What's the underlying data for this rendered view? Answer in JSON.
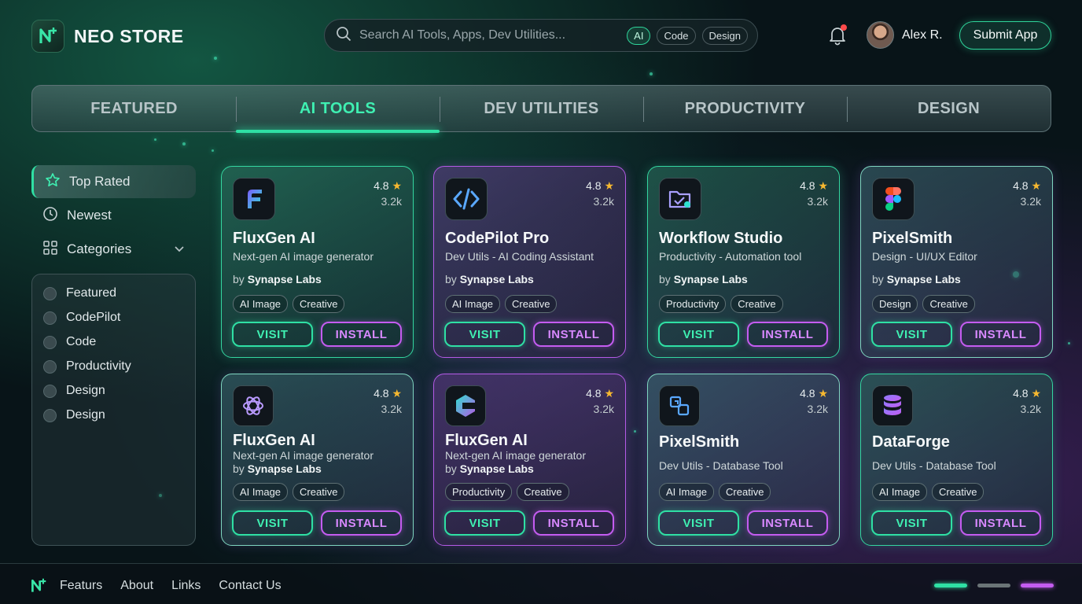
{
  "app": {
    "name": "NEO STORE"
  },
  "search": {
    "placeholder": "Search AI Tools, Apps, Dev Utilities...",
    "chips": [
      "AI",
      "Code",
      "Design"
    ],
    "active_chip": "AI"
  },
  "user": {
    "name": "Alex R."
  },
  "header": {
    "submit_label": "Submit App"
  },
  "tabs": [
    "FEATURED",
    "AI TOOLS",
    "DEV UTILITIES",
    "PRODUCTIVITY",
    "DESIGN"
  ],
  "active_tab": "AI TOOLS",
  "sidebar": {
    "items": [
      {
        "label": "Top Rated",
        "icon": "star-icon"
      },
      {
        "label": "Newest",
        "icon": "clock-icon"
      },
      {
        "label": "Categories",
        "icon": "grid-icon"
      }
    ],
    "filters": [
      "Featured",
      "CodePilot",
      "Code",
      "Productivity",
      "Design",
      "Design"
    ]
  },
  "cards": [
    {
      "title": "FluxGen AI",
      "subtitle": "Next-gen AI image generator",
      "by_prefix": "by",
      "by": "Synapse Labs",
      "rating": "4.8",
      "count": "3.2k",
      "tags": [
        "AI Image",
        "Creative"
      ],
      "visit": "VISIT",
      "install": "INSTALL",
      "icon": "fluxgen-logo-icon"
    },
    {
      "title": "CodePilot Pro",
      "subtitle": "Dev Utils - AI Coding Assistant",
      "by_prefix": "by",
      "by": "Synapse Labs",
      "rating": "4.8",
      "count": "3.2k",
      "tags": [
        "AI Image",
        "Creative"
      ],
      "visit": "VISIT",
      "install": "INSTALL",
      "icon": "code-brackets-icon"
    },
    {
      "title": "Workflow Studio",
      "subtitle": "Productivity - Automation tool",
      "by_prefix": "by",
      "by": "Synapse Labs",
      "rating": "4.8",
      "count": "3.2k",
      "tags": [
        "Productivity",
        "Creative"
      ],
      "visit": "VISIT",
      "install": "INSTALL",
      "icon": "folder-check-icon"
    },
    {
      "title": "PixelSmith",
      "subtitle": "Design - UI/UX Editor",
      "by_prefix": "by",
      "by": "Synapse Labs",
      "rating": "4.8",
      "count": "3.2k",
      "tags": [
        "Design",
        "Creative"
      ],
      "visit": "VISIT",
      "install": "INSTALL",
      "icon": "figma-logo-icon"
    },
    {
      "title": "FluxGen AI",
      "subtitle": "Next-gen AI image generator",
      "by_prefix": "by",
      "by": "Synapse Labs",
      "rating": "4.8",
      "count": "3.2k",
      "tags": [
        "AI Image",
        "Creative"
      ],
      "visit": "VISIT",
      "install": "INSTALL",
      "icon": "openai-logo-icon"
    },
    {
      "title": "FluxGen AI",
      "subtitle": "Next-gen AI image generator",
      "by_prefix": "by",
      "by": "Synapse Labs",
      "rating": "4.8",
      "count": "3.2k",
      "tags": [
        "Productivity",
        "Creative"
      ],
      "visit": "VISIT",
      "install": "INSTALL",
      "icon": "e-logo-icon"
    },
    {
      "title": "PixelSmith",
      "subtitle": "Dev Utils - Database Tool",
      "rating": "4.8",
      "count": "3.2k",
      "tags": [
        "AI Image",
        "Creative"
      ],
      "visit": "VISIT",
      "install": "INSTALL",
      "icon": "database-link-icon"
    },
    {
      "title": "DataForge",
      "subtitle": "Dev Utils - Database Tool",
      "rating": "4.8",
      "count": "3.2k",
      "tags": [
        "AI Image",
        "Creative"
      ],
      "visit": "VISIT",
      "install": "INSTALL",
      "icon": "database-icon"
    }
  ],
  "footer": {
    "links": [
      "Featurs",
      "About",
      "Links",
      "Contact Us"
    ]
  },
  "pager": {
    "total": 3,
    "active": 1
  },
  "colors": {
    "accent_green": "#2fe0a4",
    "accent_purple": "#c45cf0",
    "bg": "#081418"
  }
}
